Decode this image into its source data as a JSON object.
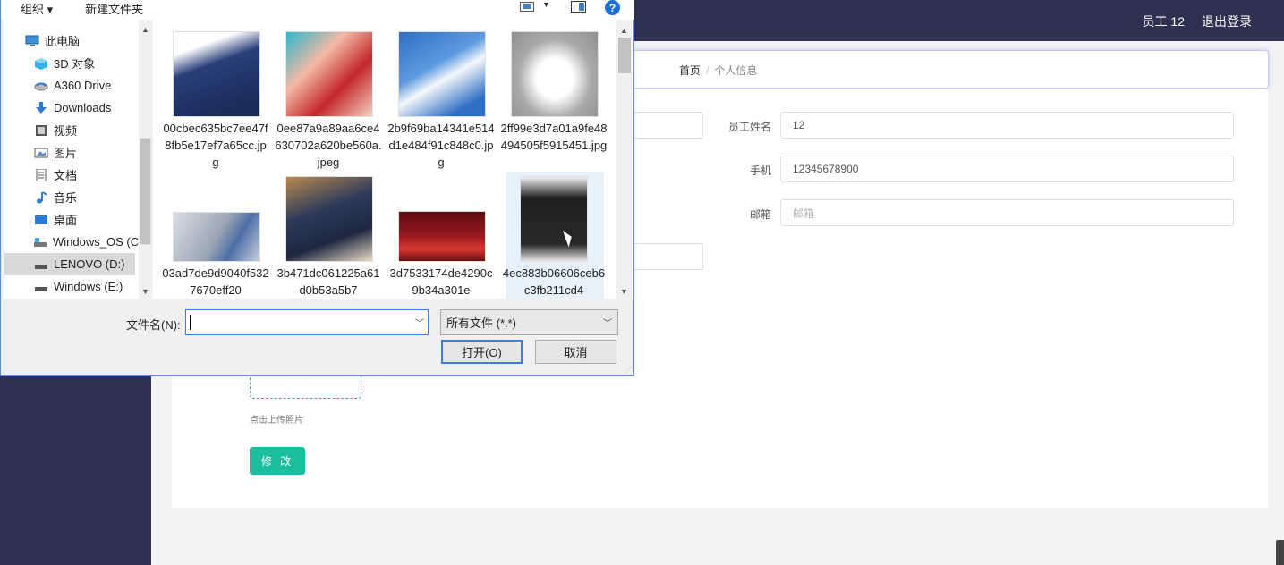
{
  "app": {
    "user_label": "员工 12",
    "logout_label": "退出登录",
    "breadcrumb_home": "首页",
    "breadcrumb_sep": "/",
    "breadcrumb_current": "个人信息",
    "fields": {
      "name_label": "员工姓名",
      "name_value": "12",
      "phone_label": "手机",
      "phone_value": "12345678900",
      "email_label": "邮箱",
      "email_placeholder": "邮箱"
    },
    "upload_hint": "点击上传照片",
    "modify_button": "修 改"
  },
  "dialog": {
    "toolbar": {
      "organize_label": "组织 ▾",
      "new_folder_label": "新建文件夹"
    },
    "nav_items": [
      {
        "label": "此电脑",
        "icon": "computer-icon"
      },
      {
        "label": "3D 对象",
        "icon": "cube-icon"
      },
      {
        "label": "A360 Drive",
        "icon": "cloud-drive-icon"
      },
      {
        "label": "Downloads",
        "icon": "download-icon"
      },
      {
        "label": "视频",
        "icon": "video-icon"
      },
      {
        "label": "图片",
        "icon": "picture-icon"
      },
      {
        "label": "文档",
        "icon": "document-icon"
      },
      {
        "label": "音乐",
        "icon": "music-icon"
      },
      {
        "label": "桌面",
        "icon": "desktop-icon"
      },
      {
        "label": "Windows_OS (C",
        "icon": "drive-icon"
      },
      {
        "label": "LENOVO (D:)",
        "icon": "drive-icon"
      },
      {
        "label": "Windows (E:)",
        "icon": "drive-icon"
      }
    ],
    "files": [
      {
        "name": "00cbec635bc7ee47f8fb5e17ef7a65cc.jpg",
        "thumb_color": "#2a3f7a"
      },
      {
        "name": "0ee87a9a89aa6ce4630702a620be560a.jpeg",
        "thumb_color": "#c3272b"
      },
      {
        "name": "2b9f69ba14341e514d1e484f91c848c0.jpg",
        "thumb_color": "#2f6fc4"
      },
      {
        "name": "2ff99e3d7a01a9fe48494505f5915451.jpg",
        "thumb_color": "#8f8f8f"
      },
      {
        "name": "03ad7de9d9040f5327670eff20",
        "thumb_color": "#b9c1cc"
      },
      {
        "name": "3b471dc061225a61d0b53a5b7",
        "thumb_color": "#2c3a5a"
      },
      {
        "name": "3d7533174de4290c9b34a301e",
        "thumb_color": "#9b1a1f"
      },
      {
        "name": "4ec883b06606ceb6c3fb211cd4",
        "thumb_color": "#1e1e1e"
      }
    ],
    "filename_label": "文件名(N):",
    "filename_value": "",
    "filetype_value": "所有文件 (*.*)",
    "open_button": "打开(O)",
    "cancel_button": "取消"
  }
}
